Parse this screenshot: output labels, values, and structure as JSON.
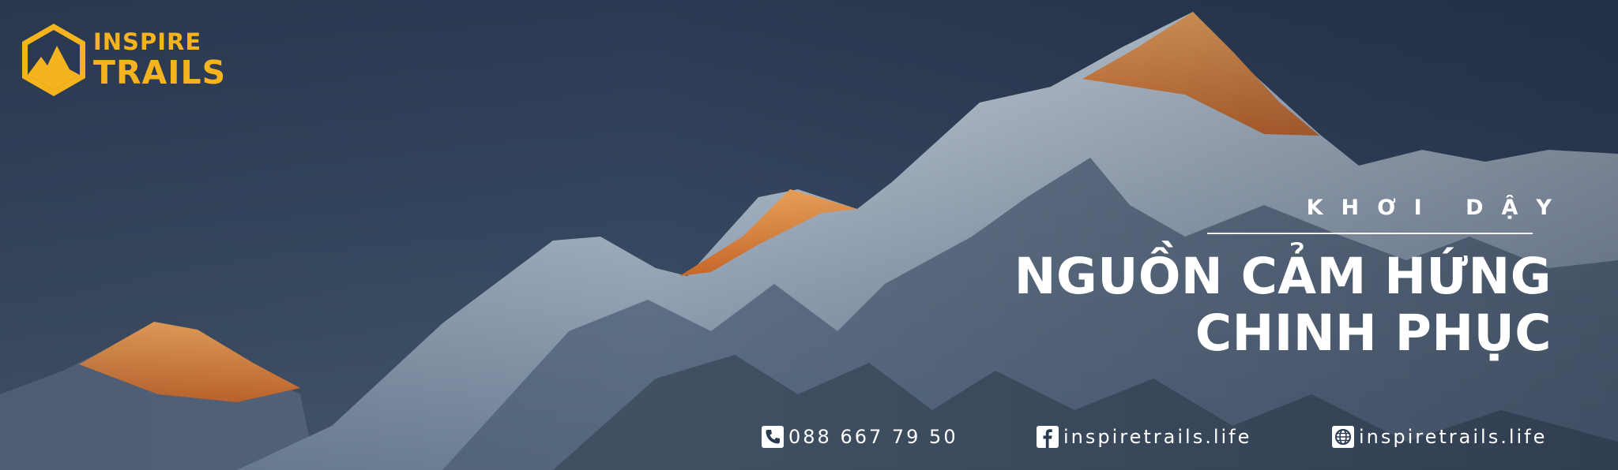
{
  "brand": {
    "line1": "INSPIRE",
    "line2": "TRAILS",
    "color": "#f5b41e"
  },
  "headline": {
    "kicker": "KHƠI DẬY",
    "title_line1": "NGUỒN CẢM HỨNG",
    "title_line2": "CHINH PHỤC"
  },
  "contacts": {
    "phone": {
      "icon": "phone-icon",
      "text": "088 667 79 50"
    },
    "facebook": {
      "icon": "facebook-icon",
      "text": "inspiretrails.life"
    },
    "website": {
      "icon": "globe-icon",
      "text": "inspiretrails.life"
    }
  }
}
